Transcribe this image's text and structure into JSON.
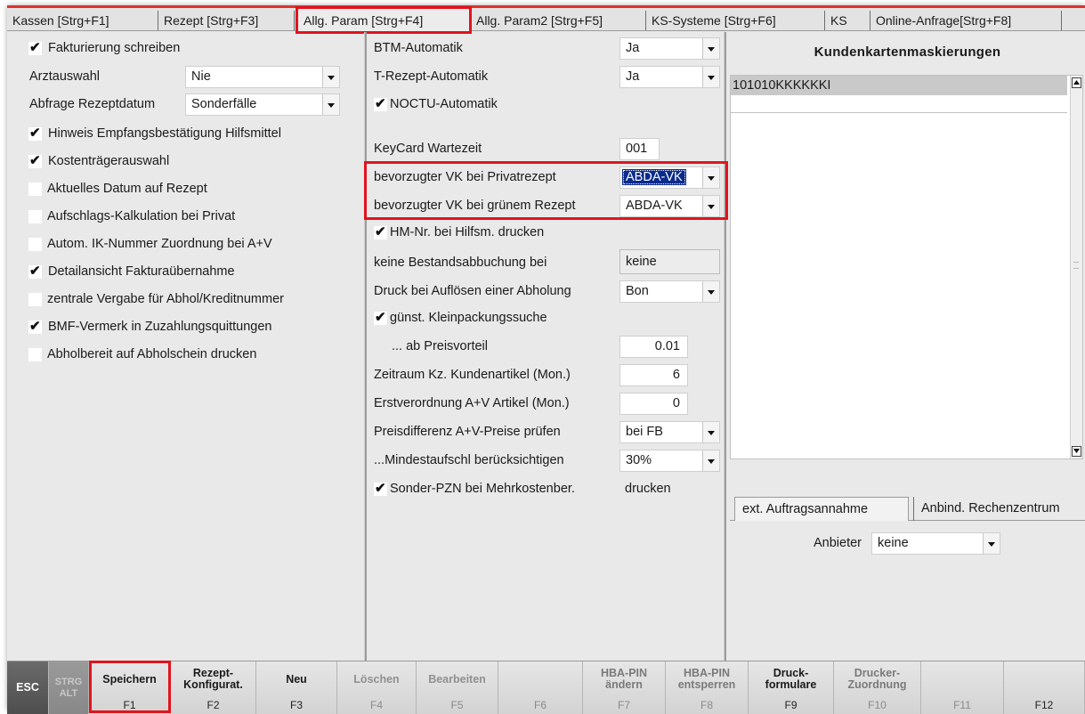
{
  "tabs": [
    {
      "label": "Kassen [Strg+F1]"
    },
    {
      "label": "Rezept [Strg+F3]"
    },
    {
      "label": "Allg. Param [Strg+F4]"
    },
    {
      "label": "Allg. Param2 [Strg+F5]"
    },
    {
      "label": "KS-Systeme [Strg+F6]"
    },
    {
      "label": "KS"
    },
    {
      "label": "Online-Anfrage[Strg+F8]"
    }
  ],
  "left": {
    "fakturierung": {
      "label": "Fakturierung schreiben",
      "checked": true
    },
    "arztauswahl": {
      "label": "Arztauswahl",
      "value": "Nie"
    },
    "abfrage": {
      "label": "Abfrage Rezeptdatum",
      "value": "Sonderfälle"
    },
    "checks": [
      {
        "label": "Hinweis Empfangsbestätigung Hilfsmittel",
        "checked": true,
        "mark": "✔"
      },
      {
        "label": "Kostenträgerauswahl",
        "checked": true,
        "mark": "✔"
      },
      {
        "label": "Aktuelles Datum auf Rezept",
        "checked": false,
        "mark": ""
      },
      {
        "label": "Aufschlags-Kalkulation bei Privat",
        "checked": false,
        "mark": ""
      },
      {
        "label": "Autom. IK-Nummer Zuordnung bei A+V",
        "checked": false,
        "mark": ""
      },
      {
        "label": "Detailansicht Fakturaübernahme",
        "checked": true,
        "mark": "✔"
      },
      {
        "label": "zentrale Vergabe für Abhol/Kreditnummer",
        "checked": false,
        "mark": ""
      },
      {
        "label": "BMF-Vermerk in Zuzahlungsquittungen",
        "checked": true,
        "mark": "✔"
      },
      {
        "label": "Abholbereit auf Abholschein drucken",
        "checked": false,
        "mark": ""
      }
    ]
  },
  "middle": {
    "btm": {
      "label": "BTM-Automatik",
      "value": "Ja"
    },
    "trezept": {
      "label": "T-Rezept-Automatik",
      "value": "Ja"
    },
    "noctu": {
      "label": "NOCTU-Automatik",
      "checked": true
    },
    "keycard": {
      "label": "KeyCard Wartezeit",
      "value": "001"
    },
    "vk_privat": {
      "label": "bevorzugter VK bei Privatrezept",
      "value": "ABDA-VK"
    },
    "vk_gruen": {
      "label": "bevorzugter VK bei grünem Rezept",
      "value": "ABDA-VK"
    },
    "hmnr": {
      "label": "HM-Nr. bei Hilfsm. drucken",
      "checked": true
    },
    "bestand": {
      "label": "keine Bestandsabbuchung bei",
      "value": "keine"
    },
    "druck_abhol": {
      "label": "Druck bei Auflösen einer Abholung",
      "value": "Bon"
    },
    "klein": {
      "label": "günst. Kleinpackungssuche",
      "checked": true
    },
    "preisvorteil": {
      "label": "... ab Preisvorteil",
      "value": "0.01"
    },
    "zeitraum": {
      "label": "Zeitraum Kz. Kundenartikel (Mon.)",
      "value": "6"
    },
    "erstverordnung": {
      "label": "Erstverordnung A+V Artikel (Mon.)",
      "value": "0"
    },
    "preisdiff": {
      "label": "Preisdifferenz A+V-Preise prüfen",
      "value": "bei FB"
    },
    "mindest": {
      "label": "...Mindestaufschl berücksichtigen",
      "value": "30%"
    },
    "sonder": {
      "label": "Sonder-PZN bei Mehrkostenber.",
      "checked": true,
      "suffix": "drucken"
    }
  },
  "right": {
    "title": "Kundenkartenmaskierungen",
    "items": [
      "101010KKKKKKI"
    ],
    "subtabs": [
      {
        "label": "ext. Auftragsannahme"
      },
      {
        "label": "Anbind. Rechenzentrum"
      }
    ],
    "anbieter": {
      "label": "Anbieter",
      "value": "keine"
    }
  },
  "fkeys": [
    {
      "label": "ESC",
      "key": ""
    },
    {
      "label": "STRG ALT",
      "key": ""
    },
    {
      "label": "Speichern",
      "key": "F1"
    },
    {
      "label": "Rezept-\nKonfigurat.",
      "key": "F2"
    },
    {
      "label": "Neu",
      "key": "F3"
    },
    {
      "label": "Löschen",
      "key": "F4"
    },
    {
      "label": "Bearbeiten",
      "key": "F5"
    },
    {
      "label": "",
      "key": "F6"
    },
    {
      "label": "HBA-PIN\nändern",
      "key": "F7"
    },
    {
      "label": "HBA-PIN\nentsperren",
      "key": "F8"
    },
    {
      "label": "Druck-\nformulare",
      "key": "F9"
    },
    {
      "label": "Drucker-\nZuordnung",
      "key": "F10"
    },
    {
      "label": "",
      "key": "F11"
    },
    {
      "label": "",
      "key": "F12"
    }
  ],
  "colors": {
    "highlight_red": "#e0141e",
    "selection_blue": "#0a2a8c"
  }
}
